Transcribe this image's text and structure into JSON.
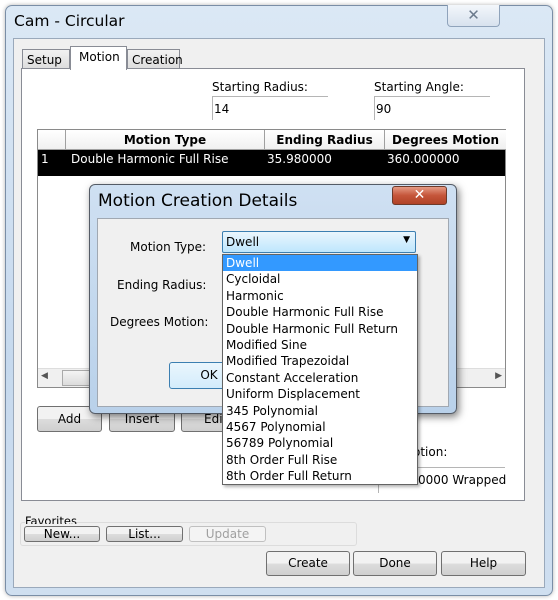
{
  "window": {
    "title": "Cam - Circular",
    "close_icon": "close-icon"
  },
  "tabs": [
    {
      "label": "Setup"
    },
    {
      "label": "Motion",
      "active": true
    },
    {
      "label": "Creation"
    }
  ],
  "motion": {
    "starting_radius_label": "Starting Radius:",
    "starting_radius": "14",
    "starting_angle_label": "Starting Angle:",
    "starting_angle": "90",
    "table": {
      "columns": [
        "",
        "Motion Type",
        "Ending Radius",
        "Degrees Motion"
      ],
      "rows": [
        [
          "1",
          "Double Harmonic Full Rise",
          "35.980000",
          "360.000000"
        ]
      ]
    },
    "buttons": {
      "add": "Add",
      "insert": "Insert",
      "edit": "Edi"
    },
    "total_label_partial": "otion:",
    "total_value_partial": "0000 Wrapped"
  },
  "favorites": {
    "label": "Favorites",
    "new": "New...",
    "list": "List...",
    "update": "Update"
  },
  "footer": {
    "create": "Create",
    "done": "Done",
    "help": "Help"
  },
  "dialog": {
    "title": "Motion Creation Details",
    "motion_type_label": "Motion Type:",
    "ending_radius_label": "Ending Radius:",
    "degrees_motion_label": "Degrees Motion:",
    "ok": "OK",
    "selected": "Dwell",
    "options": [
      "Dwell",
      "Cycloidal",
      "Harmonic",
      "Double Harmonic Full Rise",
      "Double Harmonic Full Return",
      "Modified Sine",
      "Modified Trapezoidal",
      "Constant Acceleration",
      "Uniform Displacement",
      "345 Polynomial",
      "4567 Polynomial",
      "56789 Polynomial",
      "8th Order Full Rise",
      "8th Order Full Return"
    ]
  },
  "colors": {
    "selection": "#3399ff",
    "dialog_close": "#c5553a"
  }
}
